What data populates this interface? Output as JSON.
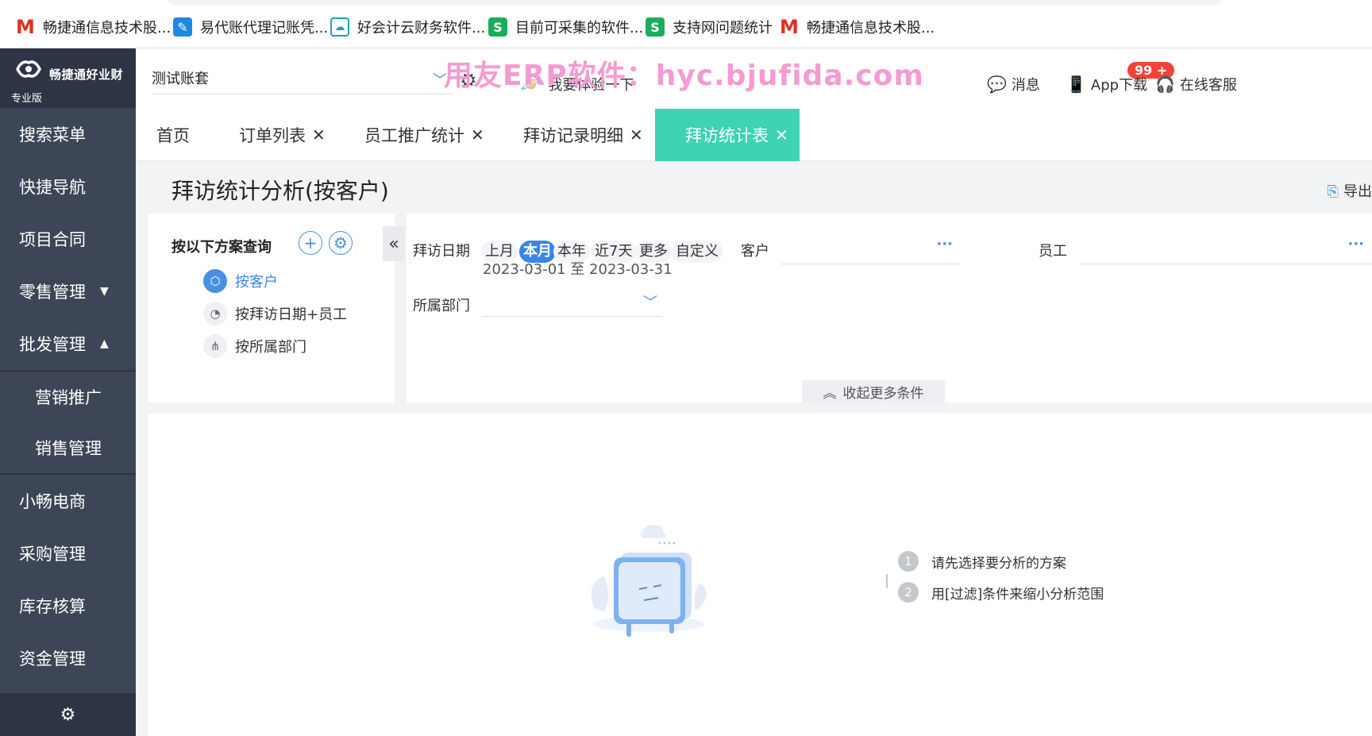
{
  "bookmarks": [
    {
      "label": "畅捷通信息技术股...",
      "icon": "m-logo-icon"
    },
    {
      "label": "易代账代理记账凭...",
      "icon": "feather-icon"
    },
    {
      "label": "好会计云财务软件...",
      "icon": "cloud-icon"
    },
    {
      "label": "目前可采集的软件...",
      "icon": "s-logo-icon"
    },
    {
      "label": "支持网问题统计",
      "icon": "s-logo-icon"
    },
    {
      "label": "畅捷通信息技术股...",
      "icon": "m-logo-icon"
    }
  ],
  "brand": {
    "name": "畅捷通好业财",
    "edition": "专业版"
  },
  "sidebar": {
    "items": [
      {
        "label": "搜索菜单"
      },
      {
        "label": "快捷导航"
      },
      {
        "label": "项目合同"
      },
      {
        "label": "零售管理",
        "arrow": "▼"
      },
      {
        "label": "批发管理",
        "arrow": "▲"
      },
      {
        "label": "营销推广"
      },
      {
        "label": "销售管理"
      },
      {
        "label": "小畅电商"
      },
      {
        "label": "采购管理"
      },
      {
        "label": "库存核算"
      },
      {
        "label": "资金管理"
      }
    ]
  },
  "header": {
    "account": "测试账套",
    "try_label": "我要体验一下",
    "watermark": "用友ERP软件：hyc.bjufida.com",
    "message_label": "消息",
    "message_badge": "99 +",
    "app_label": "App下载",
    "service_label": "在线客服"
  },
  "tabs": [
    {
      "label": "首页",
      "closable": false
    },
    {
      "label": "订单列表",
      "closable": true
    },
    {
      "label": "员工推广统计",
      "closable": true
    },
    {
      "label": "拜访记录明细",
      "closable": true
    },
    {
      "label": "拜访统计表",
      "closable": true,
      "active": true
    }
  ],
  "page": {
    "title": "拜访统计分析(按客户)",
    "export_label": "导出"
  },
  "scheme_panel": {
    "header": "按以下方案查询",
    "items": [
      {
        "label": "按客户",
        "active": true
      },
      {
        "label": "按拜访日期+员工"
      },
      {
        "label": "按所属部门"
      }
    ]
  },
  "filters": {
    "visit_date_label": "拜访日期",
    "date_chips": [
      "上月",
      "本月",
      "本年",
      "近7天",
      "更多",
      "自定义"
    ],
    "active_chip": "本月",
    "date_range": "2023-03-01 至 2023-03-31",
    "customer_label": "客户",
    "customer_value": "",
    "employee_label": "员工",
    "employee_value": "",
    "department_label": "所属部门",
    "department_value": "",
    "toggle_label": "收起更多条件"
  },
  "empty_state": {
    "tips": [
      {
        "num": "1",
        "text": "请先选择要分析的方案"
      },
      {
        "num": "2",
        "text": "用[过滤]条件来缩小分析范围"
      }
    ]
  },
  "colors": {
    "sidebar_bg": "#3d4656",
    "sidebar_dark": "#2d3444",
    "active_tab": "#3dd3b3",
    "accent_blue": "#3a86e8",
    "badge_red": "#f44336",
    "watermark_pink": "#f59bd2"
  }
}
